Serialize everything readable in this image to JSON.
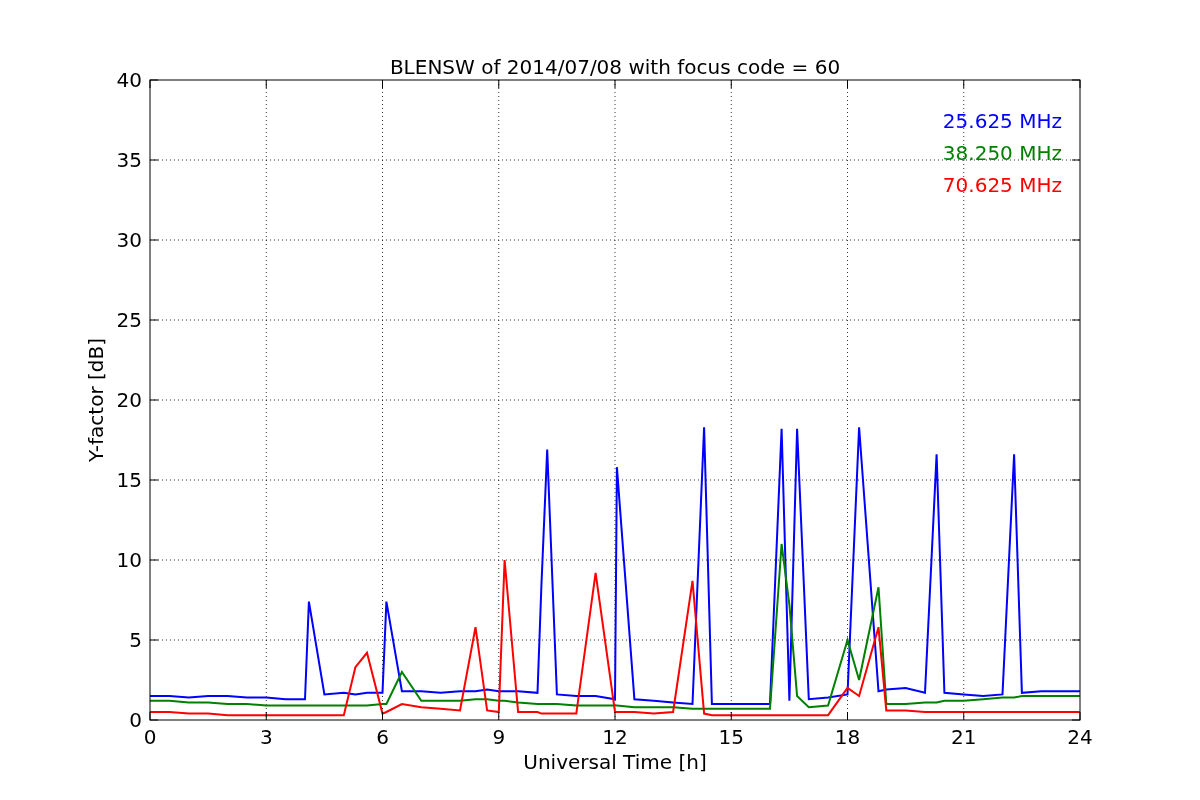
{
  "chart_data": {
    "type": "line",
    "title": "BLENSW of 2014/07/08 with focus code = 60",
    "xlabel": "Universal Time [h]",
    "ylabel": "Y-factor [dB]",
    "x": [
      0,
      0.5,
      1,
      1.5,
      2,
      2.5,
      3,
      3.5,
      4,
      4.1,
      4.5,
      5,
      5.3,
      5.6,
      6,
      6.1,
      6.5,
      7,
      7.5,
      8,
      8.4,
      8.7,
      9,
      9.15,
      9.5,
      10,
      10.1,
      10.25,
      10.5,
      11,
      11.5,
      12,
      12.05,
      12.5,
      13,
      13.5,
      14,
      14.3,
      14.5,
      15,
      15.5,
      16,
      16.3,
      16.5,
      16.7,
      17,
      17.5,
      18,
      18.3,
      18.8,
      19,
      19.5,
      20,
      20.3,
      20.5,
      21,
      21.5,
      22,
      22.3,
      22.5,
      23,
      23.5,
      24
    ],
    "series": [
      {
        "name": "25.625 MHz",
        "color": "#0000ff",
        "values": [
          1.5,
          1.5,
          1.4,
          1.5,
          1.5,
          1.4,
          1.4,
          1.3,
          1.3,
          7.4,
          1.6,
          1.7,
          1.6,
          1.7,
          1.7,
          7.4,
          1.8,
          1.8,
          1.7,
          1.8,
          1.8,
          1.9,
          1.8,
          1.8,
          1.8,
          1.7,
          8.4,
          16.9,
          1.6,
          1.5,
          1.5,
          1.3,
          15.8,
          1.3,
          1.2,
          1.1,
          1.0,
          18.3,
          1.0,
          1.0,
          1.0,
          1.0,
          18.2,
          1.2,
          18.2,
          1.3,
          1.4,
          1.6,
          18.3,
          1.8,
          1.9,
          2.0,
          1.7,
          16.6,
          1.7,
          1.6,
          1.5,
          1.6,
          16.6,
          1.7,
          1.8,
          1.8,
          1.8
        ]
      },
      {
        "name": "38.250 MHz",
        "color": "#008000",
        "values": [
          1.2,
          1.2,
          1.1,
          1.1,
          1.0,
          1.0,
          0.9,
          0.9,
          0.9,
          0.9,
          0.9,
          0.9,
          0.9,
          0.9,
          1.0,
          1.0,
          3.0,
          1.2,
          1.2,
          1.2,
          1.3,
          1.3,
          1.2,
          1.2,
          1.1,
          1.0,
          1.0,
          1.0,
          1.0,
          0.9,
          0.9,
          0.9,
          0.9,
          0.8,
          0.8,
          0.8,
          0.7,
          0.7,
          0.7,
          0.7,
          0.7,
          0.7,
          11.0,
          7.2,
          1.5,
          0.8,
          0.9,
          5.0,
          2.5,
          8.3,
          1.0,
          1.0,
          1.1,
          1.1,
          1.2,
          1.2,
          1.3,
          1.4,
          1.4,
          1.5,
          1.5,
          1.5,
          1.5
        ]
      },
      {
        "name": "70.625 MHz",
        "color": "#ff0000",
        "values": [
          0.5,
          0.5,
          0.4,
          0.4,
          0.3,
          0.3,
          0.3,
          0.3,
          0.3,
          0.3,
          0.3,
          0.3,
          3.3,
          4.2,
          0.4,
          0.5,
          1.0,
          0.8,
          0.7,
          0.6,
          5.8,
          0.6,
          0.5,
          10.0,
          0.5,
          0.5,
          0.4,
          0.4,
          0.4,
          0.4,
          9.2,
          0.5,
          0.5,
          0.5,
          0.4,
          0.5,
          8.7,
          0.4,
          0.3,
          0.3,
          0.3,
          0.3,
          0.3,
          0.3,
          0.3,
          0.3,
          0.3,
          2.0,
          1.5,
          5.8,
          0.6,
          0.6,
          0.5,
          0.5,
          0.5,
          0.5,
          0.5,
          0.5,
          0.5,
          0.5,
          0.5,
          0.5,
          0.5
        ]
      }
    ],
    "grid": true,
    "xlim": [
      0,
      24
    ],
    "ylim": [
      0,
      40
    ],
    "xticks": [
      0,
      3,
      6,
      9,
      12,
      15,
      18,
      21,
      24
    ],
    "yticks": [
      0,
      5,
      10,
      15,
      20,
      25,
      30,
      35,
      40
    ]
  }
}
